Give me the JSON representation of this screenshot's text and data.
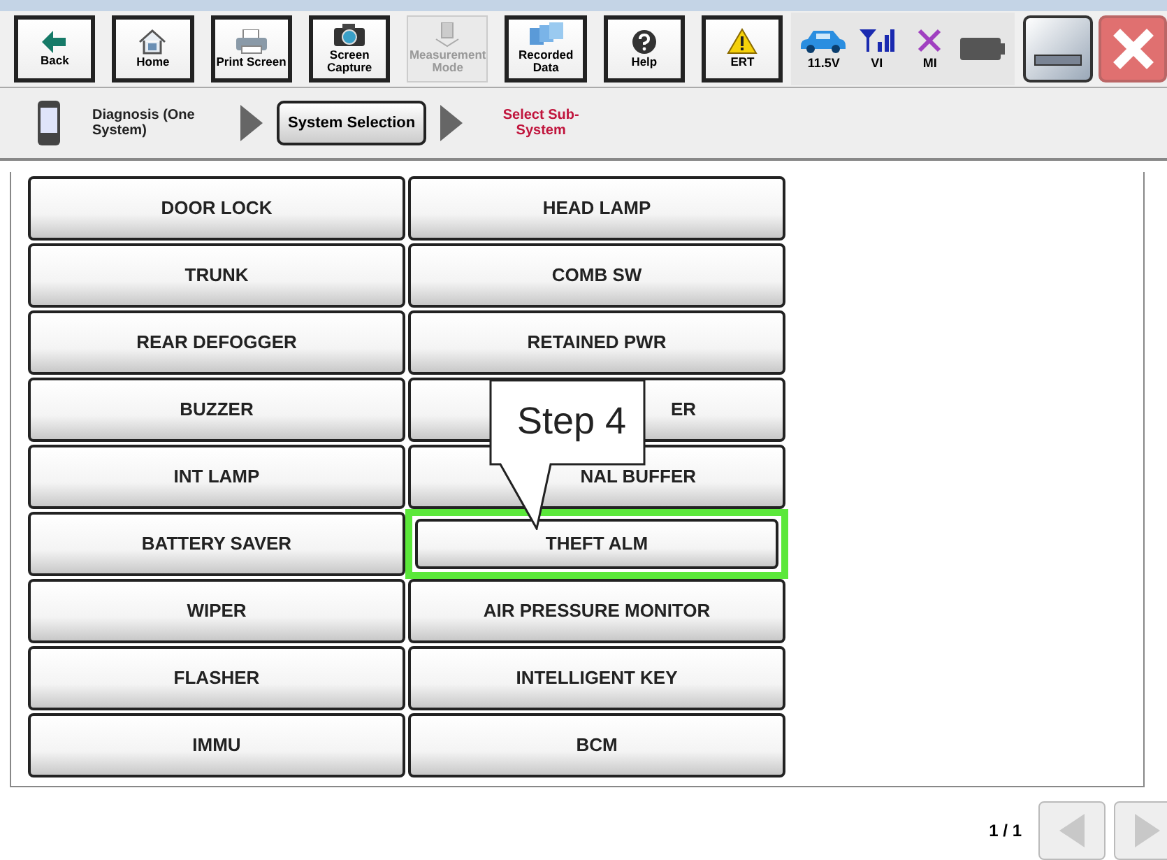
{
  "toolbar": [
    {
      "label": "Back",
      "kind": "back",
      "disabled": false
    },
    {
      "label": "Home",
      "kind": "home",
      "disabled": false
    },
    {
      "label": "Print Screen",
      "kind": "print",
      "disabled": false
    },
    {
      "label": "Screen Capture",
      "kind": "camera",
      "disabled": false
    },
    {
      "label": "Measurement Mode",
      "kind": "measure",
      "disabled": true
    },
    {
      "label": "Recorded Data",
      "kind": "folders",
      "disabled": false
    },
    {
      "label": "Help",
      "kind": "help",
      "disabled": false
    },
    {
      "label": "ERT",
      "kind": "warning",
      "disabled": false
    }
  ],
  "status": [
    {
      "label": "11.5V",
      "kind": "car"
    },
    {
      "label": "VI",
      "kind": "signal"
    },
    {
      "label": "MI",
      "kind": "cross"
    },
    {
      "kind": "battery"
    }
  ],
  "breadcrumb": [
    {
      "label": "Diagnosis (One System)",
      "kind": "plain"
    },
    {
      "label": "System Selection",
      "kind": "button"
    },
    {
      "label": "Select Sub-System",
      "kind": "current"
    }
  ],
  "systems": [
    {
      "label": "DOOR LOCK",
      "highlighted": false,
      "partial": false
    },
    {
      "label": "HEAD LAMP",
      "highlighted": false,
      "partial": false
    },
    {
      "label": "TRUNK",
      "highlighted": false,
      "partial": false
    },
    {
      "label": "COMB SW",
      "highlighted": false,
      "partial": false
    },
    {
      "label": "REAR DEFOGGER",
      "highlighted": false,
      "partial": false
    },
    {
      "label": "RETAINED PWR",
      "highlighted": false,
      "partial": false
    },
    {
      "label": "BUZZER",
      "highlighted": false,
      "partial": false
    },
    {
      "label": "ER",
      "highlighted": false,
      "partial": true
    },
    {
      "label": "INT LAMP",
      "highlighted": false,
      "partial": false
    },
    {
      "label": "NAL BUFFER",
      "highlighted": false,
      "partial": true
    },
    {
      "label": "BATTERY SAVER",
      "highlighted": false,
      "partial": false
    },
    {
      "label": "THEFT ALM",
      "highlighted": true,
      "partial": false
    },
    {
      "label": "WIPER",
      "highlighted": false,
      "partial": false
    },
    {
      "label": "AIR PRESSURE MONITOR",
      "highlighted": false,
      "partial": false
    },
    {
      "label": "FLASHER",
      "highlighted": false,
      "partial": false
    },
    {
      "label": "INTELLIGENT KEY",
      "highlighted": false,
      "partial": false
    },
    {
      "label": "IMMU",
      "highlighted": false,
      "partial": false
    },
    {
      "label": "BCM",
      "highlighted": false,
      "partial": false
    }
  ],
  "callout": {
    "text": "Step 4"
  },
  "pagination": {
    "page": "1 / 1",
    "prev_disabled": true,
    "next_disabled": true
  }
}
